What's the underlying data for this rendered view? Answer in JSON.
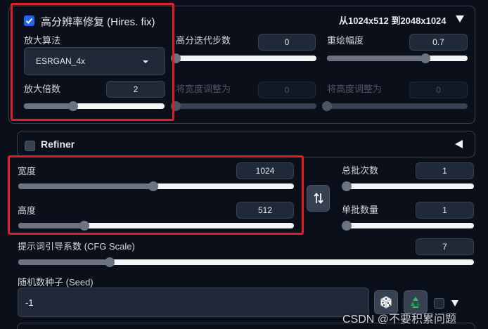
{
  "hires": {
    "enabled": true,
    "title": "高分辨率修复 (Hires. fix)",
    "summary": "从1024x512 到2048x1024",
    "upscaler_label": "放大算法",
    "upscaler_value": "ESRGAN_4x",
    "upscale_by_label": "放大倍数",
    "upscale_by_value": "2",
    "upscale_by_level": 0.35,
    "steps_label": "高分迭代步数",
    "steps_value": "0",
    "steps_level": 0.0,
    "denoise_label": "重绘幅度",
    "denoise_value": "0.7",
    "denoise_level": 0.7,
    "resize_w_label": "将宽度调整为",
    "resize_w_value": "0",
    "resize_w_level": 0.0,
    "resize_h_label": "将高度调整为",
    "resize_h_value": "0",
    "resize_h_level": 0.0
  },
  "refiner": {
    "label": "Refiner",
    "enabled": false
  },
  "size": {
    "width_label": "宽度",
    "width_value": "1024",
    "width_level": 0.49,
    "height_label": "高度",
    "height_value": "512",
    "height_level": 0.24,
    "swap_icon": "swap-vertical-arrows-icon"
  },
  "batch": {
    "count_label": "总批次数",
    "count_value": "1",
    "count_level": 0.0,
    "size_label": "单批数量",
    "size_value": "1",
    "size_level": 0.0
  },
  "cfg": {
    "label": "提示词引导系数 (CFG Scale)",
    "value": "7",
    "level": 0.2
  },
  "seed": {
    "label": "随机数种子 (Seed)",
    "value": "-1",
    "dice_icon": "dice-icon",
    "recycle_icon": "recycle-icon"
  },
  "watermark": "CSDN @不要积累问题",
  "colors": {
    "accent": "#2563eb",
    "highlight_box": "#e11d2a"
  }
}
